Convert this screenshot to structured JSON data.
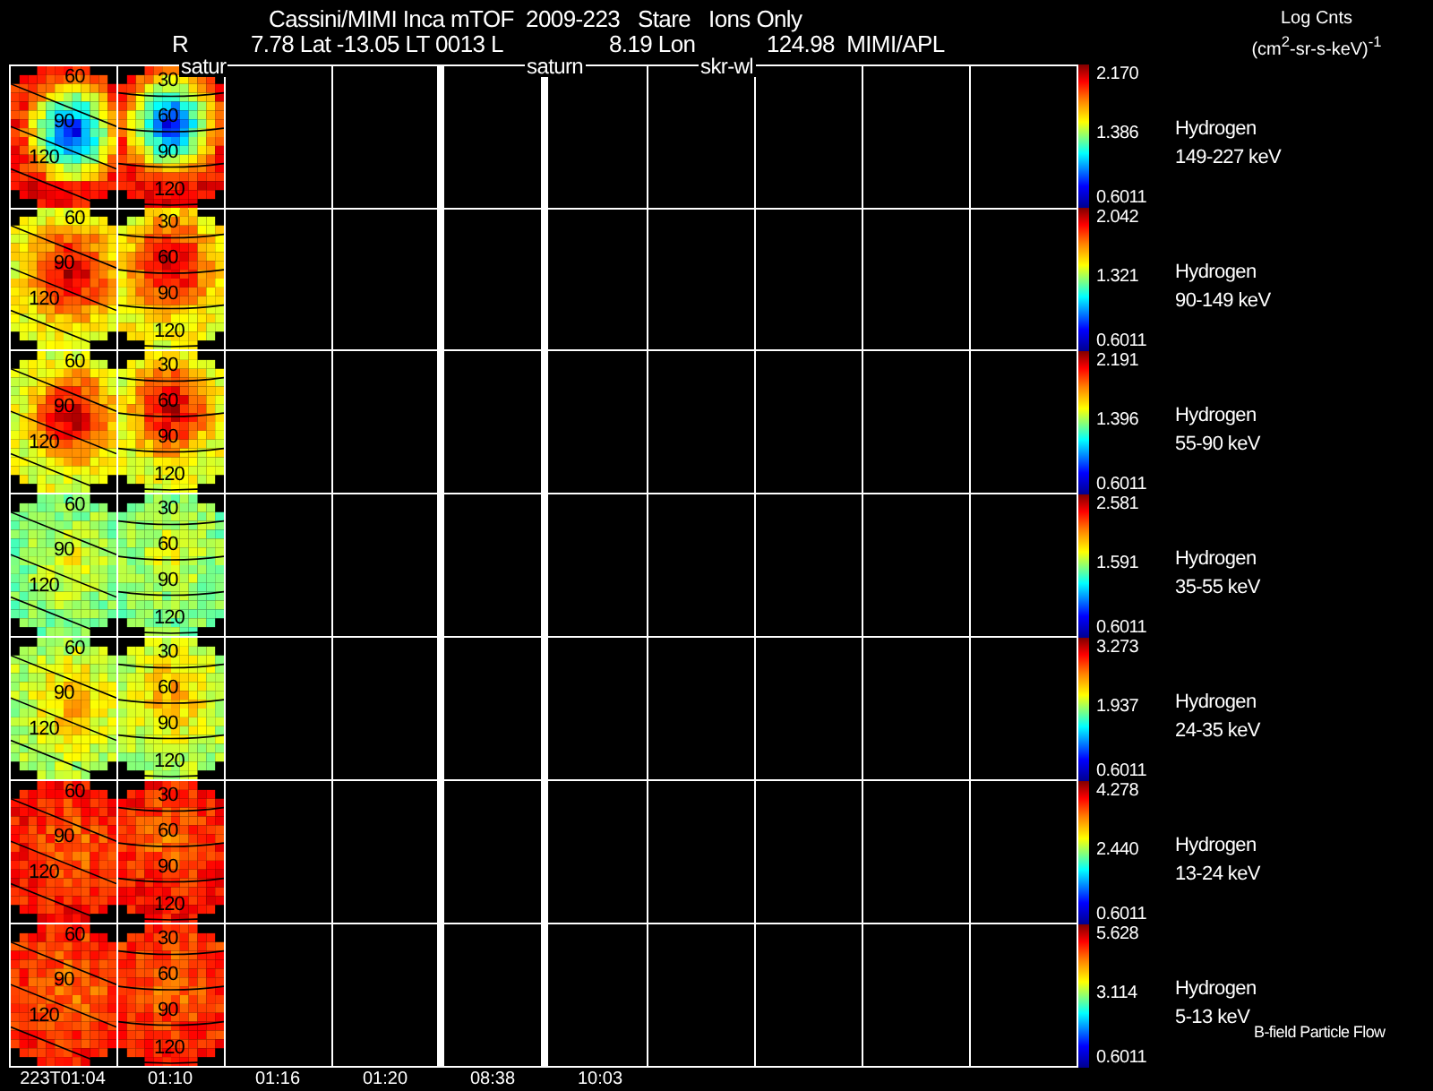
{
  "title": "Cassini/MIMI Inca mTOF  2009-223   Stare   Ions Only",
  "position": {
    "r": "R",
    "lat_lt": "7.78 Lat -13.05 LT 0013 L",
    "lon": "8.19 Lon",
    "credit": "124.98  MIMI/APL"
  },
  "units": {
    "label": "Log Cnts",
    "unit": "(cm$^{2}$-sr-s-keV)$^{-1}$"
  },
  "targets": [
    "satur",
    "saturn",
    "skr-wl"
  ],
  "columns": [
    {
      "time": "223T01:04",
      "break_before": false
    },
    {
      "time": "01:10",
      "break_before": false
    },
    {
      "time": "01:16",
      "break_before": false
    },
    {
      "time": "01:20",
      "break_before": false
    },
    {
      "time": "08:38",
      "break_before": true
    },
    {
      "time": "10:03",
      "break_before": true
    }
  ],
  "rows": [
    {
      "species": "Hydrogen",
      "energy": "149-227 keV",
      "scale": {
        "max": "2.170",
        "mid": "1.386",
        "min": "0.6011"
      },
      "panels": [
        {
          "contours": [
            "60",
            "90",
            "120"
          ]
        },
        {
          "contours": [
            "30",
            "60",
            "90",
            "120"
          ]
        }
      ]
    },
    {
      "species": "Hydrogen",
      "energy": "90-149 keV",
      "scale": {
        "max": "2.042",
        "mid": "1.321",
        "min": "0.6011"
      },
      "panels": [
        {
          "contours": [
            "60",
            "90",
            "120"
          ]
        },
        {
          "contours": [
            "30",
            "60",
            "90",
            "120"
          ]
        }
      ]
    },
    {
      "species": "Hydrogen",
      "energy": "55-90 keV",
      "scale": {
        "max": "2.191",
        "mid": "1.396",
        "min": "0.6011"
      },
      "panels": [
        {
          "contours": [
            "60",
            "90",
            "120"
          ]
        },
        {
          "contours": [
            "30",
            "60",
            "90",
            "120"
          ]
        }
      ]
    },
    {
      "species": "Hydrogen",
      "energy": "35-55 keV",
      "scale": {
        "max": "2.581",
        "mid": "1.591",
        "min": "0.6011"
      },
      "panels": [
        {
          "contours": [
            "60",
            "90",
            "120"
          ]
        },
        {
          "contours": [
            "30",
            "60",
            "90",
            "120"
          ]
        }
      ]
    },
    {
      "species": "Hydrogen",
      "energy": "24-35 keV",
      "scale": {
        "max": "3.273",
        "mid": "1.937",
        "min": "0.6011"
      },
      "panels": [
        {
          "contours": [
            "60",
            "90",
            "120"
          ]
        },
        {
          "contours": [
            "30",
            "60",
            "90",
            "120"
          ]
        }
      ]
    },
    {
      "species": "Hydrogen",
      "energy": "13-24 keV",
      "scale": {
        "max": "4.278",
        "mid": "2.440",
        "min": "0.6011"
      },
      "panels": [
        {
          "contours": [
            "60",
            "90",
            "120"
          ]
        },
        {
          "contours": [
            "30",
            "60",
            "90",
            "120"
          ]
        }
      ]
    },
    {
      "species": "Hydrogen",
      "energy": "5-13 keV",
      "scale": {
        "max": "5.628",
        "mid": "3.114",
        "min": "0.6011"
      },
      "panels": [
        {
          "contours": [
            "60",
            "90",
            "120"
          ]
        },
        {
          "contours": [
            "30",
            "60",
            "90",
            "120"
          ]
        }
      ]
    }
  ],
  "footnote": "B-field Particle Flow"
}
